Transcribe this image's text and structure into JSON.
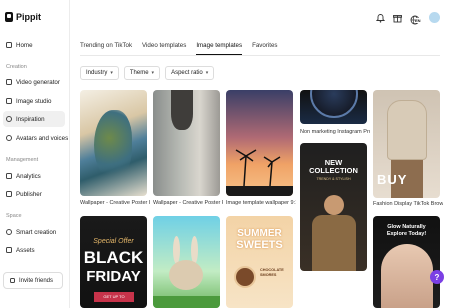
{
  "app": {
    "brand": "Pippit"
  },
  "sidebar": {
    "items": [
      {
        "label": "Home"
      },
      {
        "label": "Video generator"
      },
      {
        "label": "Image studio"
      },
      {
        "label": "Inspiration"
      },
      {
        "label": "Avatars and voices"
      },
      {
        "label": "Analytics"
      },
      {
        "label": "Publisher"
      },
      {
        "label": "Smart creation"
      },
      {
        "label": "Assets"
      }
    ],
    "sections": {
      "creation": "Creation",
      "management": "Management",
      "space": "Space"
    },
    "invite": "Invite friends"
  },
  "tabs": [
    {
      "label": "Trending on TikTok"
    },
    {
      "label": "Video templates"
    },
    {
      "label": "Image templates"
    },
    {
      "label": "Favorites"
    }
  ],
  "filters": [
    {
      "label": "Industry"
    },
    {
      "label": "Theme"
    },
    {
      "label": "Aspect ratio"
    }
  ],
  "cards": [
    {
      "caption": "Wallpaper - Creative Poster I..."
    },
    {
      "caption": "Wallpaper - Creative Poster P..."
    },
    {
      "caption": "Image template wallpaper 9:1..."
    },
    {
      "caption": "Non marketing Instagram Pro..."
    },
    {
      "caption": "Fashion Display TikTok Brown..."
    }
  ],
  "card_texts": {
    "new_collection": "NEW COLLECTION",
    "trendy": "TRENDY & STYLISH",
    "buy": "BUY",
    "special": "Special Offer",
    "black": "BLACK",
    "friday": "FRIDAY",
    "get_up": "GET UP TO",
    "summer": "SUMMER",
    "sweets": "SWEETS",
    "choc": "CHOCOLATE",
    "smores": "SMORES",
    "glow": "Glow Naturally",
    "explore": "Explore Today!"
  },
  "top_icons": [
    "bell-icon",
    "gift-icon",
    "globe-icon"
  ],
  "lang_badge": "EN",
  "colors": {
    "accent": "#7b3fe4",
    "active_bg": "#f0f0f0"
  }
}
